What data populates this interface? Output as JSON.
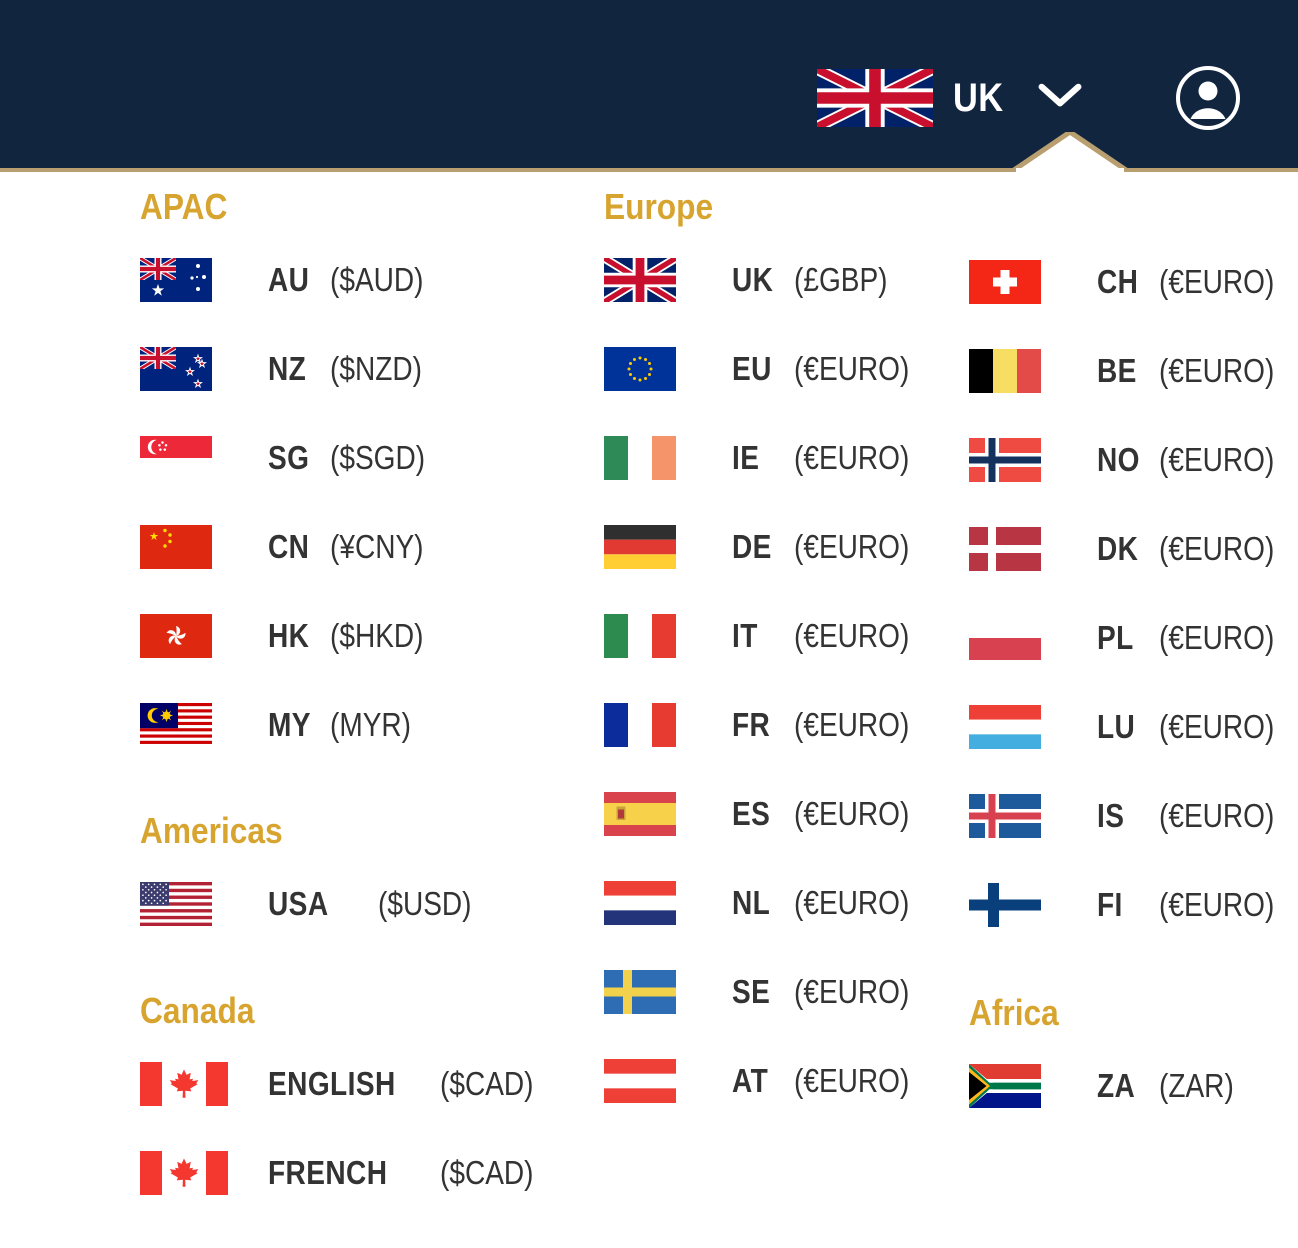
{
  "header": {
    "current_locale_code": "UK",
    "current_locale_flag": "uk-flag-icon",
    "chevron_icon": "chevron-down-icon",
    "account_icon": "user-account-icon",
    "bar_color": "#12253f",
    "accent_color": "#b99f6f"
  },
  "theme": {
    "heading_color": "#d8a430",
    "text_color": "#333333",
    "background": "#ffffff"
  },
  "groups": [
    {
      "id": "apac",
      "title": "APAC",
      "column": 1,
      "items": [
        {
          "flag": "au",
          "code": "AU",
          "currency": "($AUD)"
        },
        {
          "flag": "nz",
          "code": "NZ",
          "currency": "($NZD)"
        },
        {
          "flag": "sg",
          "code": "SG",
          "currency": "($SGD)"
        },
        {
          "flag": "cn",
          "code": "CN",
          "currency": "(¥CNY)"
        },
        {
          "flag": "hk",
          "code": "HK",
          "currency": "($HKD)"
        },
        {
          "flag": "my",
          "code": "MY",
          "currency": "(MYR)"
        }
      ]
    },
    {
      "id": "americas",
      "title": "Americas",
      "column": 1,
      "items": [
        {
          "flag": "us",
          "code": "USA",
          "currency": "($USD)"
        }
      ]
    },
    {
      "id": "canada",
      "title": "Canada",
      "column": 1,
      "items": [
        {
          "flag": "ca",
          "code": "ENGLISH",
          "currency": "($CAD)"
        },
        {
          "flag": "ca",
          "code": "FRENCH",
          "currency": "($CAD)"
        }
      ]
    },
    {
      "id": "europe",
      "title": "Europe",
      "column": 2,
      "items": [
        {
          "flag": "uk",
          "code": "UK",
          "currency": "(£GBP)"
        },
        {
          "flag": "eu",
          "code": "EU",
          "currency": "(€EURO)"
        },
        {
          "flag": "ie",
          "code": "IE",
          "currency": "(€EURO)"
        },
        {
          "flag": "de",
          "code": "DE",
          "currency": "(€EURO)"
        },
        {
          "flag": "it",
          "code": "IT",
          "currency": "(€EURO)"
        },
        {
          "flag": "fr",
          "code": "FR",
          "currency": "(€EURO)"
        },
        {
          "flag": "es",
          "code": "ES",
          "currency": "(€EURO)"
        },
        {
          "flag": "nl",
          "code": "NL",
          "currency": "(€EURO)"
        },
        {
          "flag": "se",
          "code": "SE",
          "currency": "(€EURO)"
        },
        {
          "flag": "at",
          "code": "AT",
          "currency": "(€EURO)"
        }
      ]
    },
    {
      "id": "europe-2",
      "title": "",
      "column": 3,
      "items": [
        {
          "flag": "ch",
          "code": "CH",
          "currency": "(€EURO)"
        },
        {
          "flag": "be",
          "code": "BE",
          "currency": "(€EURO)"
        },
        {
          "flag": "no",
          "code": "NO",
          "currency": "(€EURO)"
        },
        {
          "flag": "dk",
          "code": "DK",
          "currency": "(€EURO)"
        },
        {
          "flag": "pl",
          "code": "PL",
          "currency": "(€EURO)"
        },
        {
          "flag": "lu",
          "code": "LU",
          "currency": "(€EURO)"
        },
        {
          "flag": "is",
          "code": "IS",
          "currency": "(€EURO)"
        },
        {
          "flag": "fi",
          "code": "FI",
          "currency": "(€EURO)"
        }
      ]
    },
    {
      "id": "africa",
      "title": "Africa",
      "column": 3,
      "items": [
        {
          "flag": "za",
          "code": "ZA",
          "currency": "(ZAR)"
        }
      ]
    }
  ]
}
